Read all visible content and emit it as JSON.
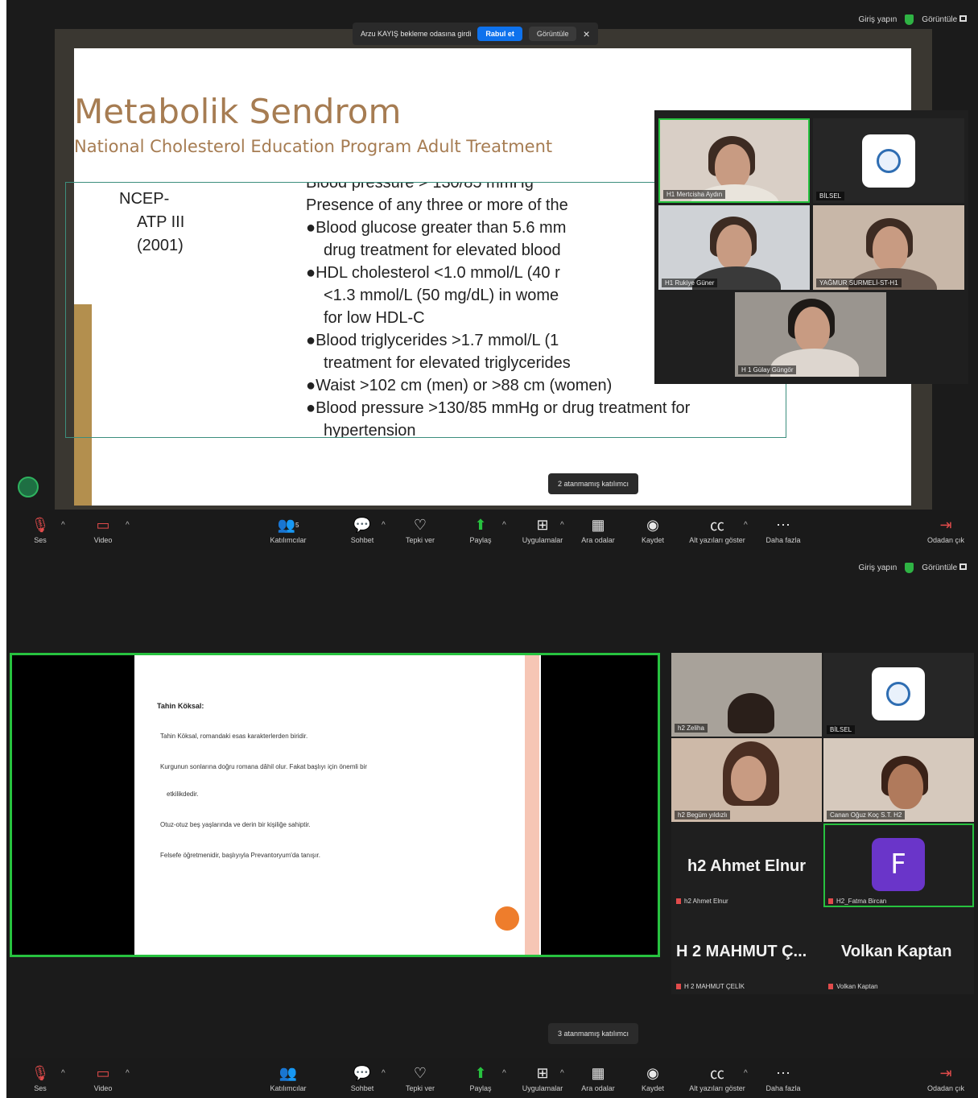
{
  "top_bar": {
    "signin": "Giriş yapın",
    "view": "Görüntüle"
  },
  "waiting_banner": {
    "message": "Arzu KAYIŞ bekleme odasına girdi",
    "accept": "Rabul et",
    "view": "Görüntüle",
    "close": "×"
  },
  "slide1": {
    "title": "Metabolik Sendrom",
    "subtitle": "National Cholesterol Education Program Adult Treatment",
    "left_label": [
      "NCEP-",
      "ATP III",
      "(2001)"
    ],
    "criteria": [
      "Blood pressure > 130/85 mmHg",
      "Presence of any three or more of the",
      "●Blood glucose greater than 5.6 mm",
      "drug treatment for elevated blood",
      "●HDL cholesterol <1.0 mmol/L (40 r",
      "<1.3 mmol/L (50 mg/dL) in wome",
      "for low HDL-C",
      "●Blood triglycerides >1.7 mmol/L (1",
      "treatment for elevated triglycerides",
      "●Waist >102 cm (men) or >88 cm (women)",
      "●Blood pressure >130/85 mmHg or drug treatment for",
      "hypertension"
    ]
  },
  "gallery1": [
    {
      "name": "H1 Mertcisha Aydın"
    },
    {
      "name": "BİLSEL"
    },
    {
      "name": "H1 Rukiye Güner"
    },
    {
      "name": "YAĞMUR SURMELİ-ST-H1"
    },
    {
      "name": "H 1 Gülay Güngör"
    }
  ],
  "toolbar": {
    "audio": "Ses",
    "video": "Video",
    "participants": "Katılımcılar",
    "participants_count": "5",
    "chat": "Sohbet",
    "react": "Tepki ver",
    "share": "Paylaş",
    "apps": "Uygulamalar",
    "breakout": "Ara odalar",
    "record": "Kaydet",
    "captions": "Alt yazıları göster",
    "more": "Daha fazla",
    "leave": "Odadan çık"
  },
  "tooltip1": "2 atanmamış katılımcı",
  "tooltip2": "3 atanmamış katılımcı",
  "slide2": {
    "heading": "Tahin Köksal:",
    "items": [
      "Tahin Köksal, romandaki esas karakterlerden biridir.",
      "Kurgunun sonlarına doğru romana dâhil olur. Fakat başlıyı için önemli bir",
      "etkilikdedir.",
      "Otuz-otuz beş yaşlarında ve derin bir kişiliğe sahiptir.",
      "Felsefe öğretmenidir, başlıyıyla Prevantoryum'da tanışır."
    ]
  },
  "gallery2": [
    {
      "name": "h2 Zeliha"
    },
    {
      "name": "BİLSEL"
    },
    {
      "name": "h2 Begüm yıldızlı"
    },
    {
      "name": "Canan Oğuz Koç S.T. H2"
    },
    {
      "big": "h2 Ahmet Elnur",
      "name": "h2 Ahmet Elnur"
    },
    {
      "avatar": "F",
      "name": "H2_Fatma Bircan"
    },
    {
      "big": "H 2 MAHMUT Ç...",
      "name": "H 2 MAHMUT ÇELİK"
    },
    {
      "big": "Volkan Kaptan",
      "name": "Volkan Kaptan"
    }
  ],
  "colors": {
    "accent_green": "#27c23f",
    "accept_blue": "#0e72ed",
    "slide_title": "#a67c52",
    "avatar_purple": "#6a35c9"
  }
}
